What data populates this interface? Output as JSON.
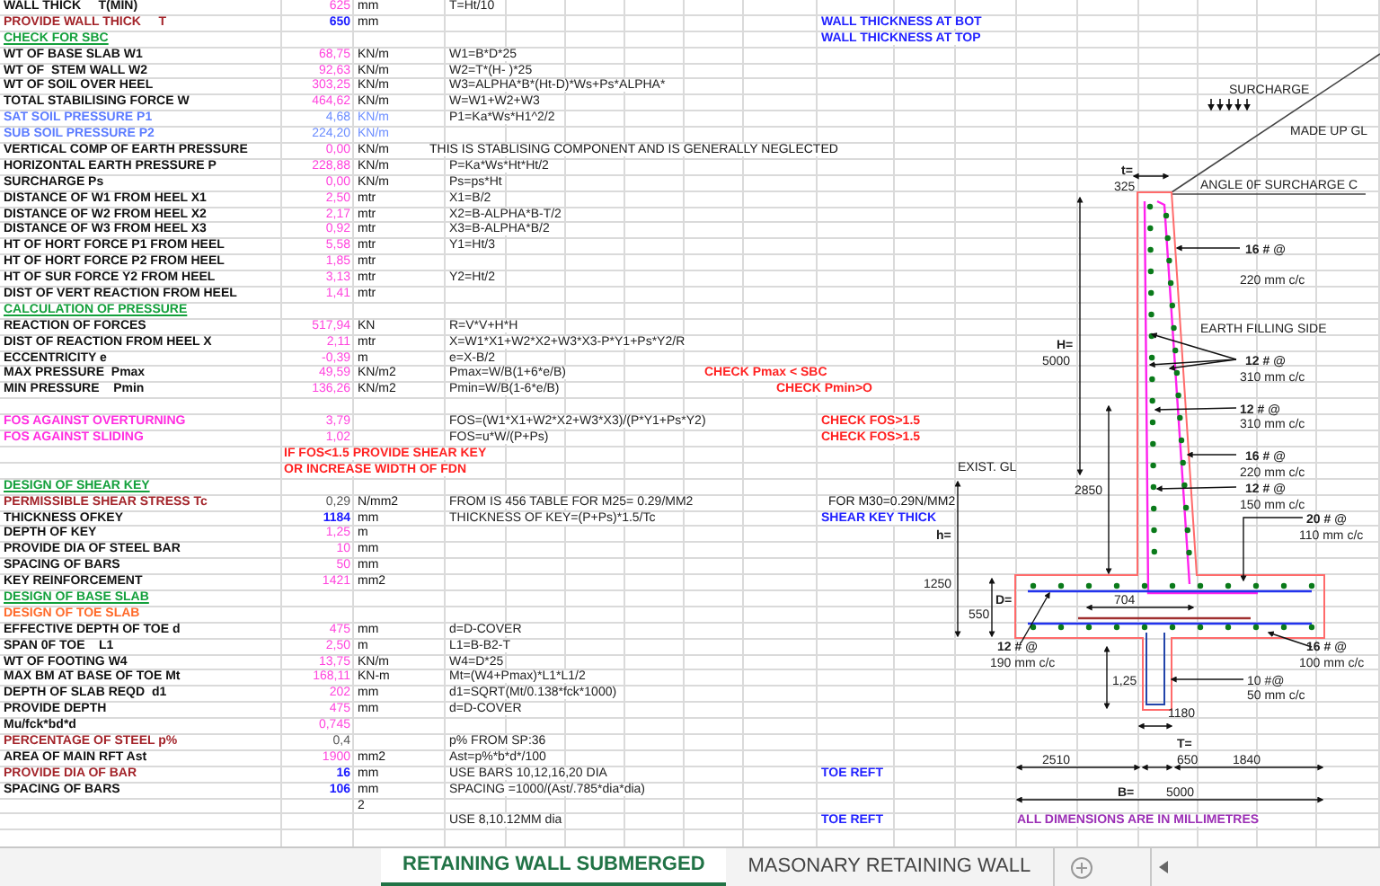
{
  "rows": [
    {
      "label": {
        "text": "WALL THICK     T(MIN)",
        "kind": "normal"
      },
      "value": {
        "text": "625",
        "kind": "calc"
      },
      "unit": "mm",
      "formula": "T=Ht/10"
    },
    {
      "label": {
        "text": "PROVIDE WALL THICK     T",
        "kind": "input"
      },
      "value": {
        "text": "650",
        "kind": "input"
      },
      "unit": "mm",
      "notes": [
        {
          "text": "WALL THICKNESS AT BOT",
          "kind": "remark"
        }
      ]
    },
    {
      "label": {
        "text": "CHECK FOR SBC",
        "kind": "heading"
      },
      "notes": [
        {
          "text": "WALL THICKNESS AT TOP",
          "kind": "remark"
        }
      ]
    },
    {
      "label": {
        "text": "WT OF BASE SLAB W1",
        "kind": "normal"
      },
      "value": {
        "text": "68,75",
        "kind": "calc"
      },
      "unit": "KN/m",
      "formula": "W1=B*D*25"
    },
    {
      "label": {
        "text": "WT OF  STEM WALL W2",
        "kind": "normal"
      },
      "value": {
        "text": "92,63",
        "kind": "calc"
      },
      "unit": "KN/m",
      "formula": "W2=T*(H- )*25"
    },
    {
      "label": {
        "text": "WT OF SOIL OVER HEEL",
        "kind": "normal"
      },
      "value": {
        "text": "303,25",
        "kind": "calc"
      },
      "unit": "KN/m",
      "formula": "W3=ALPHA*B*(Ht-D)*Ws+Ps*ALPHA*"
    },
    {
      "label": {
        "text": "TOTAL STABILISING FORCE W",
        "kind": "normal"
      },
      "value": {
        "text": "464,62",
        "kind": "calc"
      },
      "unit": "KN/m",
      "formula": "W=W1+W2+W3"
    },
    {
      "label": {
        "text": "SAT SOIL PRESSURE P1",
        "kind": "soil"
      },
      "value": {
        "text": "4,68",
        "kind": "soil"
      },
      "unit": "KN/m",
      "formula": "P1=Ka*Ws*H1^2/2"
    },
    {
      "label": {
        "text": "SUB SOIL PRESSURE P2",
        "kind": "soil"
      },
      "value": {
        "text": "224,20",
        "kind": "soil"
      },
      "unit": "KN/m"
    },
    {
      "label": {
        "text": "VERTICAL COMP OF EARTH PRESSURE",
        "kind": "normal"
      },
      "value": {
        "text": "0,00",
        "kind": "calc"
      },
      "unit": "KN/m",
      "notes": [
        {
          "text": "THIS IS STABLISING COMPONENT AND IS GENERALLY NEGLECTED",
          "kind": "plain"
        }
      ]
    },
    {
      "label": {
        "text": "HORIZONTAL EARTH PRESSURE P",
        "kind": "normal"
      },
      "value": {
        "text": "228,88",
        "kind": "calc"
      },
      "unit": "KN/m",
      "formula": "P=Ka*Ws*Ht*Ht/2"
    },
    {
      "label": {
        "text": "SURCHARGE Ps",
        "kind": "normal"
      },
      "value": {
        "text": "0,00",
        "kind": "calc"
      },
      "unit": "KN/m",
      "formula": "Ps=ps*Ht"
    },
    {
      "label": {
        "text": "DISTANCE OF W1 FROM HEEL X1",
        "kind": "normal"
      },
      "value": {
        "text": "2,50",
        "kind": "calc"
      },
      "unit": "mtr",
      "formula": "X1=B/2"
    },
    {
      "label": {
        "text": "DISTANCE OF W2 FROM HEEL X2",
        "kind": "normal"
      },
      "value": {
        "text": "2,17",
        "kind": "calc"
      },
      "unit": "mtr",
      "formula": "X2=B-ALPHA*B-T/2"
    },
    {
      "label": {
        "text": "DISTANCE OF W3 FROM HEEL X3",
        "kind": "normal"
      },
      "value": {
        "text": "0,92",
        "kind": "calc"
      },
      "unit": "mtr",
      "formula": "X3=B-ALPHA*B/2"
    },
    {
      "label": {
        "text": "HT OF HORT FORCE P1 FROM HEEL",
        "kind": "normal"
      },
      "value": {
        "text": "5,58",
        "kind": "calc"
      },
      "unit": "mtr",
      "formula": "Y1=Ht/3"
    },
    {
      "label": {
        "text": "HT OF HORT FORCE P2 FROM HEEL",
        "kind": "normal"
      },
      "value": {
        "text": "1,85",
        "kind": "calc"
      },
      "unit": "mtr"
    },
    {
      "label": {
        "text": "HT OF SUR FORCE Y2 FROM HEEL",
        "kind": "normal"
      },
      "value": {
        "text": "3,13",
        "kind": "calc"
      },
      "unit": "mtr",
      "formula": "Y2=Ht/2"
    },
    {
      "label": {
        "text": "DIST OF VERT REACTION FROM HEEL",
        "kind": "normal"
      },
      "value": {
        "text": "1,41",
        "kind": "calc"
      },
      "unit": "mtr"
    },
    {
      "label": {
        "text": "CALCULATION OF PRESSURE",
        "kind": "heading"
      }
    },
    {
      "label": {
        "text": "REACTION OF FORCES",
        "kind": "normal"
      },
      "value": {
        "text": "517,94",
        "kind": "calc"
      },
      "unit": "KN",
      "formula": "R=V*V+H*H"
    },
    {
      "label": {
        "text": "DIST OF REACTION FROM HEEL X",
        "kind": "normal"
      },
      "value": {
        "text": "2,11",
        "kind": "calc"
      },
      "unit": "mtr",
      "formula": "X=W1*X1+W2*X2+W3*X3-P*Y1+Ps*Y2/R"
    },
    {
      "label": {
        "text": "ECCENTRICITY e",
        "kind": "normal"
      },
      "value": {
        "text": "-0,39",
        "kind": "calc"
      },
      "unit": "m",
      "formula": "e=X-B/2"
    },
    {
      "label": {
        "text": "MAX PRESSURE  Pmax",
        "kind": "normal"
      },
      "value": {
        "text": "49,59",
        "kind": "calc"
      },
      "unit": "KN/m2",
      "formula": "Pmax=W/B(1+6*e/B)",
      "notes": [
        {
          "text": "CHECK  Pmax < SBC",
          "kind": "check"
        }
      ]
    },
    {
      "label": {
        "text": "MIN PRESSURE    Pmin",
        "kind": "normal"
      },
      "value": {
        "text": "136,26",
        "kind": "calc"
      },
      "unit": "KN/m2",
      "formula": "Pmin=W/B(1-6*e/B)",
      "notes": [
        {
          "text": "CHECK  Pmin>O",
          "kind": "check"
        }
      ]
    },
    {},
    {
      "label": {
        "text": "FOS AGAINST OVERTURNING",
        "kind": "fos"
      },
      "value": {
        "text": "3,79",
        "kind": "calc"
      },
      "formula": "FOS=(W1*X1+W2*X2+W3*X3)/(P*Y1+Ps*Y2)",
      "notes": [
        {
          "text": "CHECK FOS>1.5",
          "kind": "check"
        }
      ]
    },
    {
      "label": {
        "text": "FOS AGAINST SLIDING",
        "kind": "fos"
      },
      "value": {
        "text": "1,02",
        "kind": "calc"
      },
      "formula": "FOS=u*W/(P+Ps)",
      "notes": [
        {
          "text": "CHECK FOS>1.5",
          "kind": "check"
        }
      ]
    },
    {
      "notes": [
        {
          "text": "IF FOS<1.5 PROVIDE SHEAR KEY",
          "kind": "check"
        }
      ]
    },
    {
      "notes": [
        {
          "text": "OR INCREASE WIDTH OF FDN",
          "kind": "check"
        }
      ]
    },
    {
      "label": {
        "text": "DESIGN OF SHEAR KEY",
        "kind": "heading"
      }
    },
    {
      "label": {
        "text": "PERMISSIBLE SHEAR STRESS Tc",
        "kind": "input"
      },
      "value": {
        "text": "0,29",
        "kind": "plain"
      },
      "unit": "N/mm2",
      "formula": "FROM IS 456 TABLE  FOR M25= 0.29/MM2",
      "notes": [
        {
          "text": "FOR M30=0.29N/MM2",
          "kind": "plain"
        }
      ]
    },
    {
      "label": {
        "text": "THICKNESS OFKEY",
        "kind": "normal"
      },
      "value": {
        "text": "1184",
        "kind": "input"
      },
      "unit": "mm",
      "formula": "THICKNESS OF KEY=(P+Ps)*1.5/Tc",
      "notes": [
        {
          "text": "SHEAR KEY THICK",
          "kind": "remark"
        }
      ]
    },
    {
      "label": {
        "text": "DEPTH OF KEY",
        "kind": "normal"
      },
      "value": {
        "text": "1,25",
        "kind": "calc"
      },
      "unit": "m"
    },
    {
      "label": {
        "text": "PROVIDE DIA OF STEEL BAR",
        "kind": "normal"
      },
      "value": {
        "text": "10",
        "kind": "calc"
      },
      "unit": "mm"
    },
    {
      "label": {
        "text": "SPACING OF BARS",
        "kind": "normal"
      },
      "value": {
        "text": "50",
        "kind": "calc"
      },
      "unit": "mm"
    },
    {
      "label": {
        "text": "KEY REINFORCEMENT",
        "kind": "normal"
      },
      "value": {
        "text": "1421",
        "kind": "calc"
      },
      "unit": "mm2"
    },
    {
      "label": {
        "text": "DESIGN OF BASE SLAB",
        "kind": "heading"
      }
    },
    {
      "label": {
        "text": "DESIGN OF TOE SLAB",
        "kind": "subheading"
      }
    },
    {
      "label": {
        "text": "EFFECTIVE DEPTH OF TOE d",
        "kind": "normal"
      },
      "value": {
        "text": "475",
        "kind": "calc"
      },
      "unit": "mm",
      "formula": "d=D-COVER"
    },
    {
      "label": {
        "text": "SPAN 0F TOE    L1",
        "kind": "normal"
      },
      "value": {
        "text": "2,50",
        "kind": "calc"
      },
      "unit": "m",
      "formula": "L1=B-B2-T"
    },
    {
      "label": {
        "text": "WT OF FOOTING W4",
        "kind": "normal"
      },
      "value": {
        "text": "13,75",
        "kind": "calc"
      },
      "unit": "KN/m",
      "formula": "W4=D*25"
    },
    {
      "label": {
        "text": "MAX BM AT BASE OF TOE Mt",
        "kind": "normal"
      },
      "value": {
        "text": "168,11",
        "kind": "calc"
      },
      "unit": "KN-m",
      "formula": "Mt=(W4+Pmax)*L1*L1/2"
    },
    {
      "label": {
        "text": "DEPTH OF SLAB REQD  d1",
        "kind": "normal"
      },
      "value": {
        "text": "202",
        "kind": "calc"
      },
      "unit": "mm",
      "formula": "d1=SQRT(Mt/0.138*fck*1000)"
    },
    {
      "label": {
        "text": "PROVIDE DEPTH",
        "kind": "normal"
      },
      "value": {
        "text": "475",
        "kind": "calc"
      },
      "unit": "mm",
      "formula": "d=D-COVER"
    },
    {
      "label": {
        "text": "Mu/fck*bd*d",
        "kind": "normal"
      },
      "value": {
        "text": "0,745",
        "kind": "calc"
      }
    },
    {
      "label": {
        "text": "PERCENTAGE OF STEEL p%",
        "kind": "input"
      },
      "value": {
        "text": "0,4",
        "kind": "plain"
      },
      "formula": "p% FROM SP:36"
    },
    {
      "label": {
        "text": "AREA OF MAIN RFT Ast",
        "kind": "normal"
      },
      "value": {
        "text": "1900",
        "kind": "calc"
      },
      "unit": "mm2",
      "formula": "Ast=p%*b*d*/100"
    },
    {
      "label": {
        "text": "PROVIDE DIA OF BAR",
        "kind": "input"
      },
      "value": {
        "text": "16",
        "kind": "input"
      },
      "unit": "mm",
      "formula": "USE BARS 10,12,16,20 DIA",
      "notes": [
        {
          "text": "TOE REFT",
          "kind": "remark"
        }
      ]
    },
    {
      "label": {
        "text": "SPACING OF BARS",
        "kind": "normal"
      },
      "value": {
        "text": "106",
        "kind": "input"
      },
      "unit": "mm",
      "formula": "SPACING =1000/(Ast/.785*dia*dia)"
    },
    {
      "unit": "2"
    },
    {
      "formula": "USE 8,10.12MM dia",
      "notes": [
        {
          "text": "TOE REFT",
          "kind": "remark"
        },
        {
          "text": "ALL DIMENSIONS ARE IN MILLIMETRES",
          "kind": "dims"
        }
      ]
    }
  ],
  "drawing": {
    "labels": [
      {
        "text": "SURCHARGE",
        "kind": "plain"
      },
      {
        "text": "MADE UP GL",
        "kind": "plain"
      },
      {
        "text": "t=",
        "kind": "bold"
      },
      {
        "text": "325",
        "kind": "plain"
      },
      {
        "text": "ANGLE 0F SURCHARGE C",
        "kind": "plain"
      },
      {
        "text": "16 # @",
        "kind": "bold"
      },
      {
        "text": "220 mm c/c",
        "kind": "plain"
      },
      {
        "text": "EARTH FILLING SIDE",
        "kind": "plain"
      },
      {
        "text": "H=",
        "kind": "bold"
      },
      {
        "text": "5000",
        "kind": "plain"
      },
      {
        "text": "12 # @",
        "kind": "bold"
      },
      {
        "text": "310 mm c/c",
        "kind": "plain"
      },
      {
        "text": "12 # @",
        "kind": "bold"
      },
      {
        "text": "310 mm c/c",
        "kind": "plain"
      },
      {
        "text": "EXIST. GL",
        "kind": "plain"
      },
      {
        "text": "2850",
        "kind": "plain"
      },
      {
        "text": "16 # @",
        "kind": "bold"
      },
      {
        "text": "220 mm c/c",
        "kind": "plain"
      },
      {
        "text": "12 # @",
        "kind": "bold"
      },
      {
        "text": "150 mm c/c",
        "kind": "plain"
      },
      {
        "text": "20 # @",
        "kind": "bold"
      },
      {
        "text": "110 mm c/c",
        "kind": "plain"
      },
      {
        "text": "h=",
        "kind": "bold"
      },
      {
        "text": "1250",
        "kind": "plain"
      },
      {
        "text": "D=",
        "kind": "bold"
      },
      {
        "text": "550",
        "kind": "plain"
      },
      {
        "text": "704",
        "kind": "plain"
      },
      {
        "text": "12 # @",
        "kind": "bold"
      },
      {
        "text": "190 mm c/c",
        "kind": "plain"
      },
      {
        "text": "16 # @",
        "kind": "bold"
      },
      {
        "text": "100 mm c/c",
        "kind": "plain"
      },
      {
        "text": "1,25",
        "kind": "plain"
      },
      {
        "text": "10 #@",
        "kind": "plain"
      },
      {
        "text": "50 mm c/c",
        "kind": "plain"
      },
      {
        "text": "1180",
        "kind": "plain"
      },
      {
        "text": "T=",
        "kind": "bold"
      },
      {
        "text": "2510",
        "kind": "plain"
      },
      {
        "text": "650",
        "kind": "plain"
      },
      {
        "text": "1840",
        "kind": "plain"
      },
      {
        "text": "B=",
        "kind": "bold"
      },
      {
        "text": "5000",
        "kind": "plain"
      }
    ]
  },
  "sheet_tabs": [
    {
      "label": "RETAINING WALL SUBMERGED",
      "selected": true
    },
    {
      "label": "MASONARY RETAINING WALL",
      "selected": false
    }
  ]
}
